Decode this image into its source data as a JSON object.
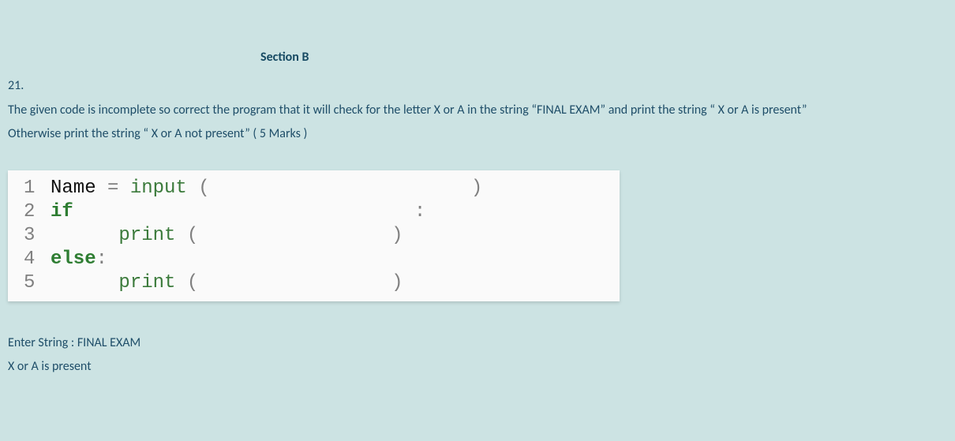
{
  "section_title": "Section B",
  "question_number": "21.",
  "question_line1": "The given code is incomplete so correct the program that it will check for the letter X or  A in the string “FINAL EXAM” and print the string “ X or A  is   present”",
  "question_line2": "Otherwise print the string “ X or A  not  present”     ( 5 Marks )",
  "code": {
    "l1": {
      "no": "1",
      "id": "Name ",
      "op": "=",
      "fn": " input ",
      "open": "(",
      "gap": "                       ",
      "close": ")"
    },
    "l2": {
      "no": "2",
      "kw": "if",
      "gap": "                              ",
      "colon": ":"
    },
    "l3": {
      "no": "3",
      "indent": "      ",
      "fn": "print ",
      "open": "(",
      "gap": "                 ",
      "close": ")"
    },
    "l4": {
      "no": "4",
      "kw": "else",
      "colon": ":"
    },
    "l5": {
      "no": "5",
      "indent": "      ",
      "fn": "print ",
      "open": "(",
      "gap": "                 ",
      "close": ")"
    }
  },
  "output_line1": "Enter String : FINAL EXAM",
  "output_line2": "X or A is present"
}
